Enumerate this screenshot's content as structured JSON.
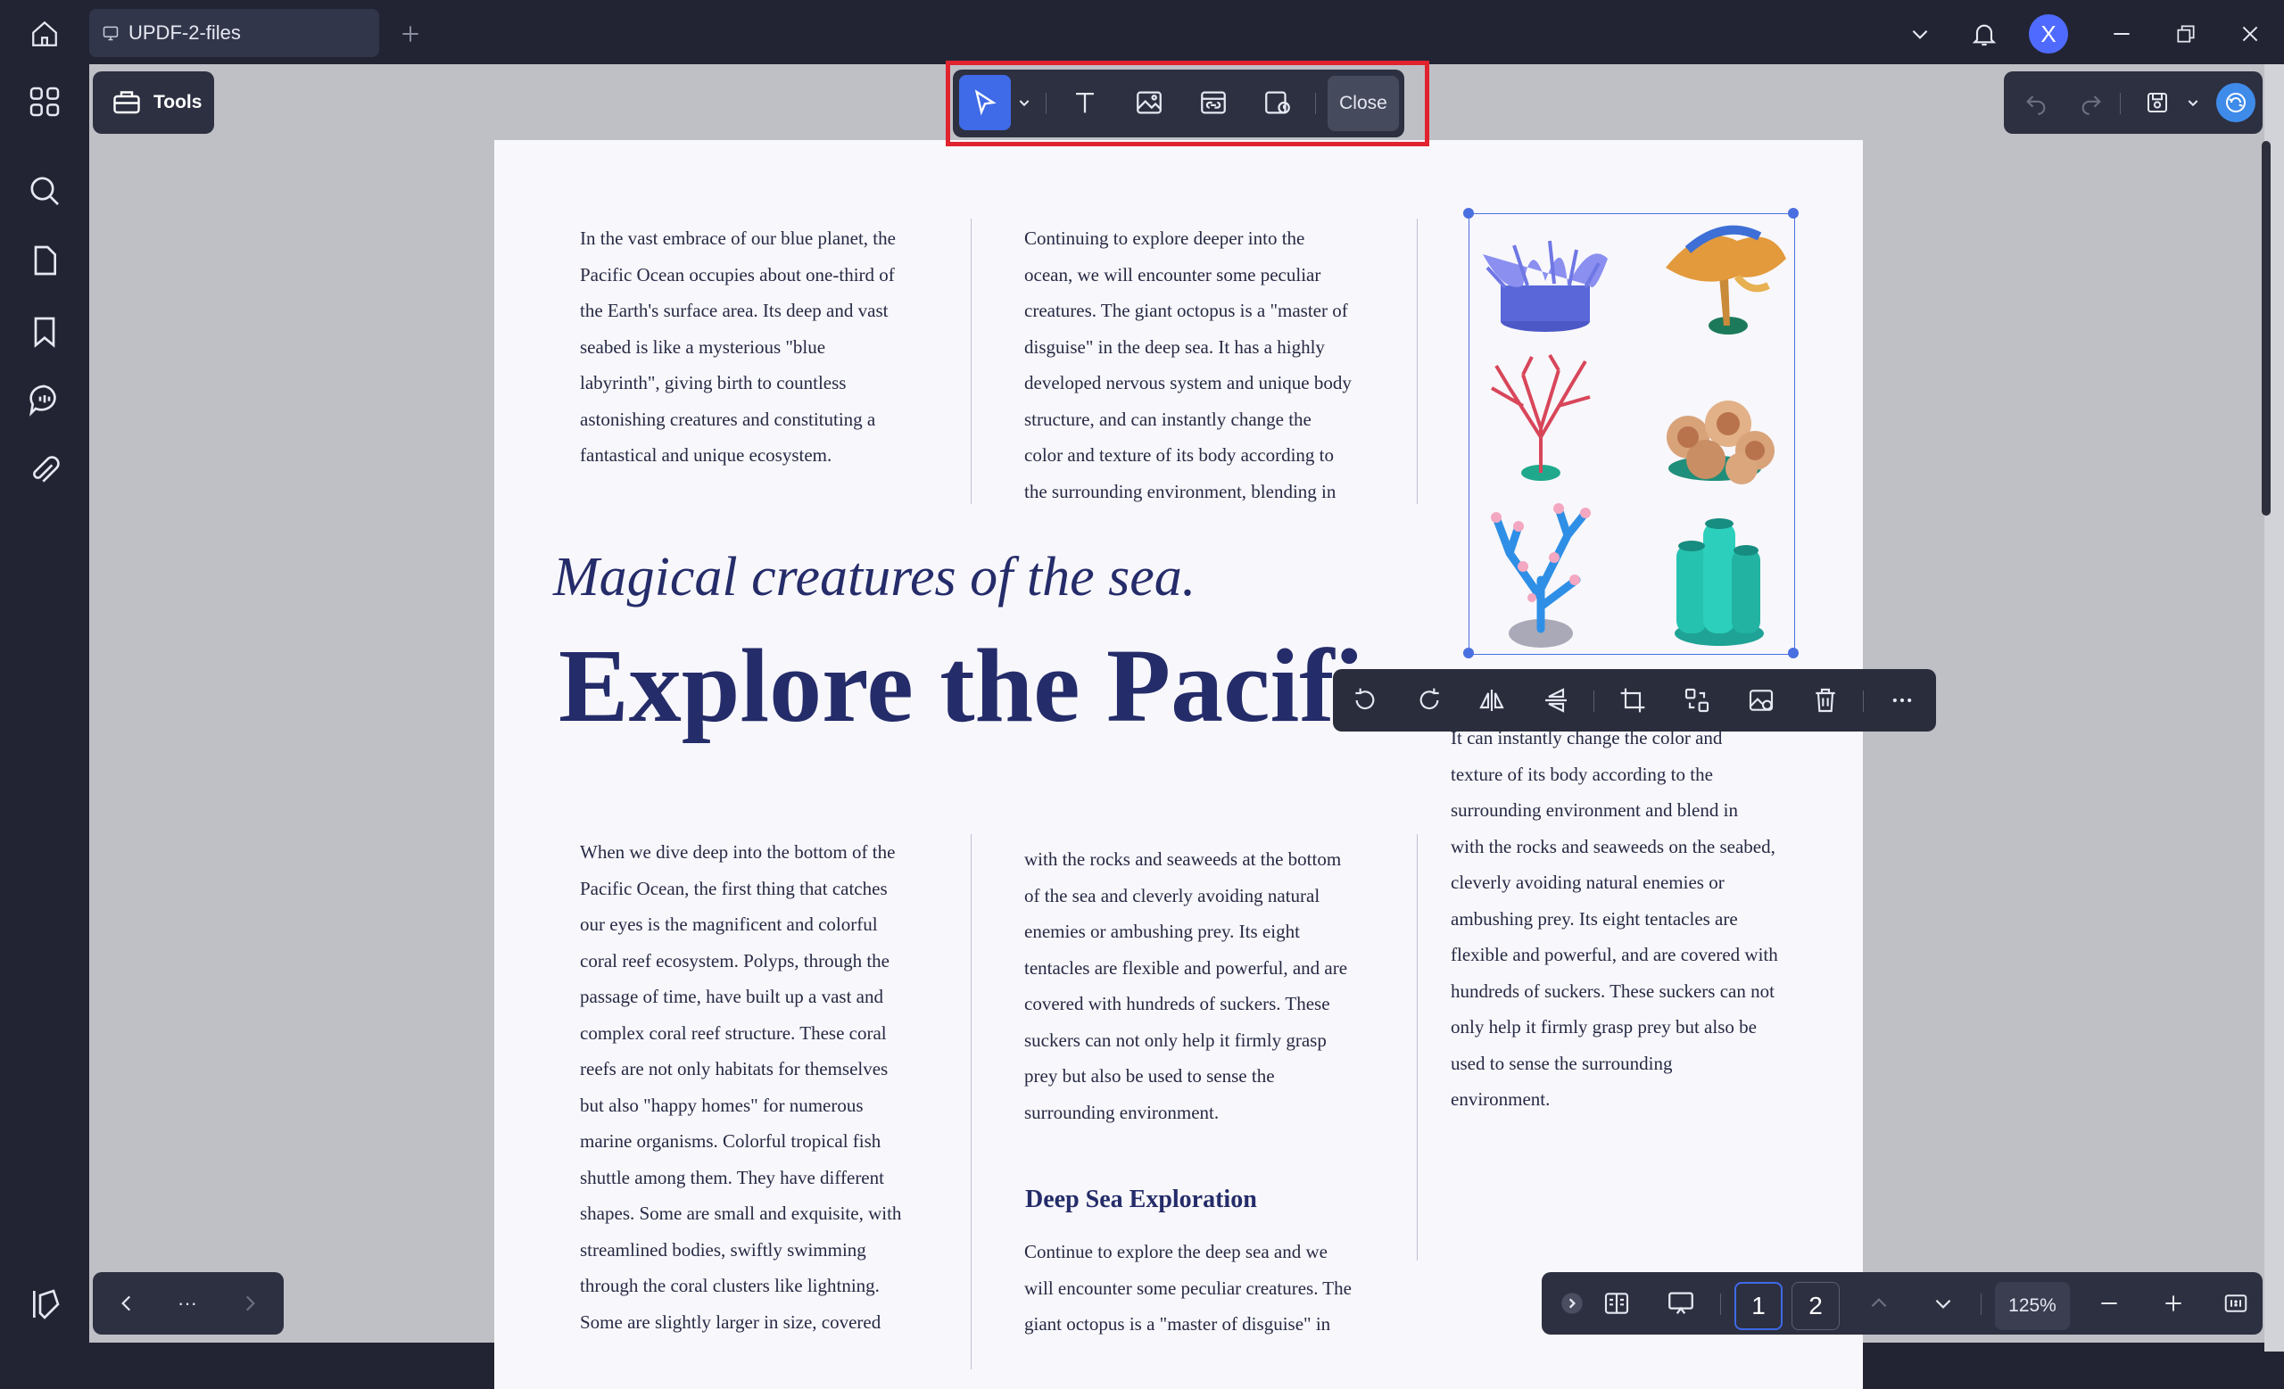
{
  "tab": {
    "title": "UPDF-2-files"
  },
  "user": {
    "initial": "X"
  },
  "tools": {
    "label": "Tools"
  },
  "edit_toolbar": {
    "close_label": "Close"
  },
  "page": {
    "col1_top": [
      "In the vast embrace of our blue planet, the",
      "Pacific Ocean occupies about one-third of",
      "the Earth's surface area. Its deep and vast",
      "seabed is like a mysterious \"blue",
      "labyrinth\", giving birth to countless",
      "astonishing creatures and constituting a",
      "fantastical and unique ecosystem."
    ],
    "col2_top": [
      "Continuing to explore deeper into the",
      "ocean, we will encounter some peculiar",
      "creatures. The giant octopus is a \"master of",
      "disguise\" in the deep sea. It has a highly",
      "developed nervous system and unique body",
      "structure, and can instantly change the",
      "color and texture of its body according to",
      "the surrounding environment, blending in"
    ],
    "italic_heading": "Magical creatures of the sea.",
    "big_heading": "Explore the Pacifi",
    "col1_bottom": [
      "When we dive deep into the bottom of the",
      "Pacific Ocean, the first thing that catches",
      "our eyes is the magnificent and colorful",
      "coral reef ecosystem. Polyps, through the",
      "passage of time, have built up a vast and",
      "complex coral reef structure. These coral",
      "reefs are not only habitats for themselves",
      "but also \"happy homes\" for numerous",
      "marine organisms. Colorful tropical fish",
      "shuttle among them. They have different",
      "shapes. Some are small and exquisite, with",
      "streamlined bodies, swiftly swimming",
      "through the coral clusters like lightning.",
      "Some are slightly larger in size, covered"
    ],
    "col2_bottom": [
      "with the rocks and seaweeds at the bottom",
      "of the sea and cleverly avoiding natural",
      "enemies or ambushing prey. Its eight",
      "tentacles are flexible and powerful, and are",
      "covered with hundreds of suckers. These",
      "suckers can not only help it firmly grasp",
      "prey but also be used to sense the",
      "surrounding environment."
    ],
    "subheading": "Deep Sea Exploration",
    "col2_sub": [
      "Continue to explore the deep sea and we",
      "will encounter some peculiar creatures. The",
      "giant octopus is a \"master of disguise\" in"
    ],
    "col3_bottom": [
      "It can instantly change the color and",
      "texture of its body according to the",
      "surrounding environment and blend in",
      "with the rocks and seaweeds on the seabed,",
      "cleverly avoiding natural enemies or",
      "ambushing prey. Its eight tentacles are",
      "flexible and powerful, and are covered with",
      "hundreds of suckers. These suckers can not",
      "only help it firmly grasp prey but also be",
      "used to sense the surrounding",
      "environment."
    ]
  },
  "nav": {
    "more_label": "···"
  },
  "pager": {
    "page1": "1",
    "page2": "2",
    "zoom": "125%"
  },
  "colors": {
    "accent": "#3f6ae8",
    "highlight": "#e0232e",
    "heading": "#252c6a"
  }
}
